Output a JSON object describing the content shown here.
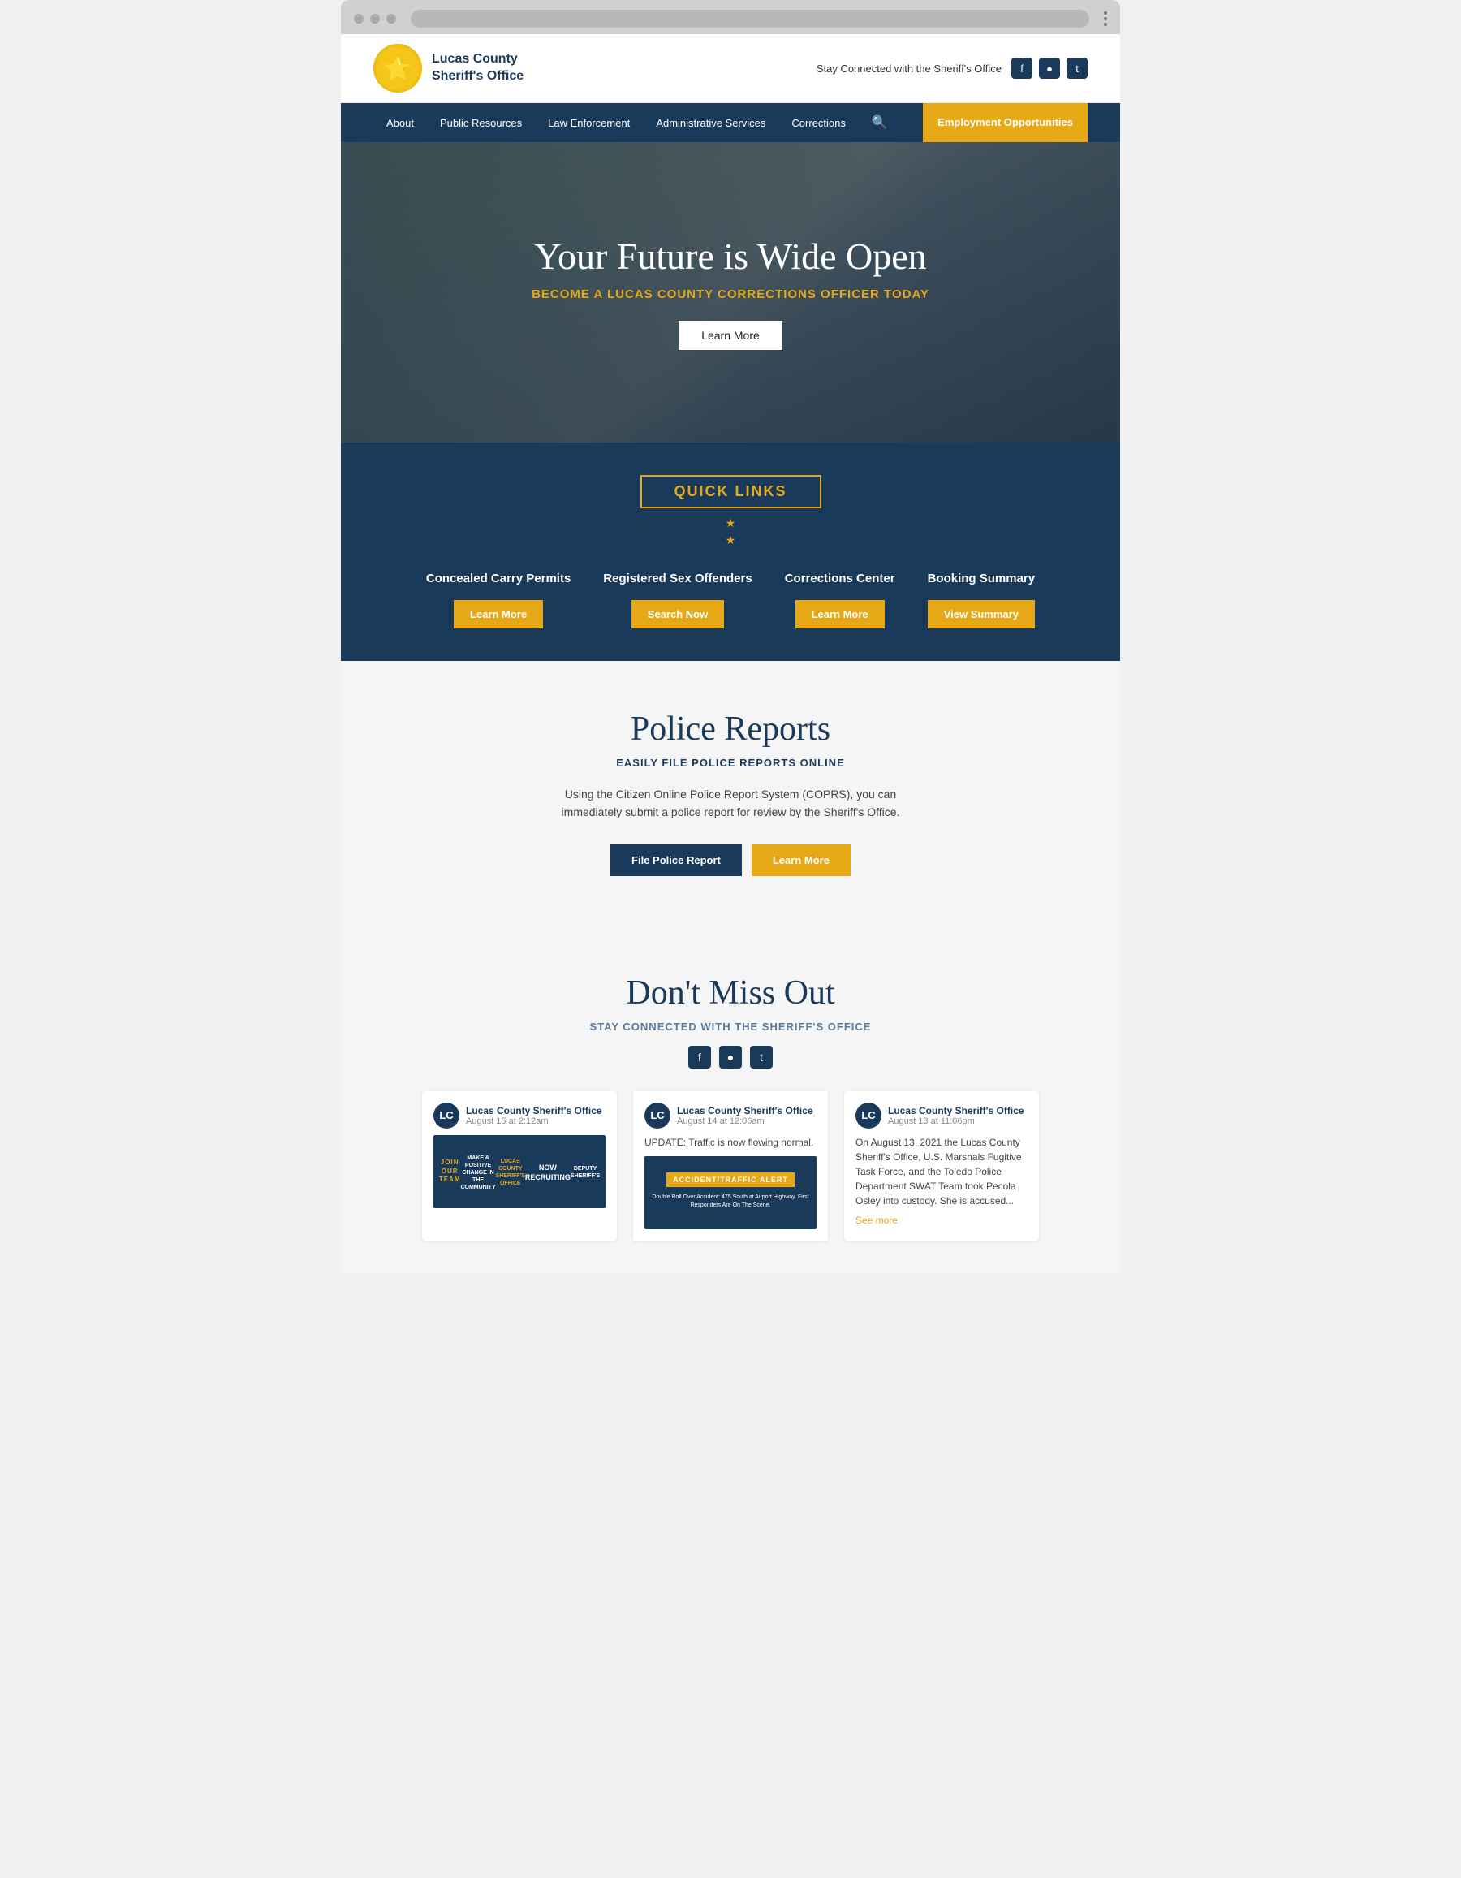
{
  "browser": {
    "dots": [
      "red-dot",
      "yellow-dot",
      "green-dot"
    ]
  },
  "header": {
    "logo_badge": "⭐",
    "logo_line1": "Lucas County",
    "logo_line2": "Sheriff's Office",
    "stay_connected": "Stay Connected with the Sheriff's Office",
    "social": {
      "facebook": "f",
      "instagram": "📷",
      "twitter": "t"
    }
  },
  "nav": {
    "items": [
      {
        "label": "About",
        "id": "about"
      },
      {
        "label": "Public Resources",
        "id": "public-resources"
      },
      {
        "label": "Law Enforcement",
        "id": "law-enforcement"
      },
      {
        "label": "Administrative Services",
        "id": "administrative-services"
      },
      {
        "label": "Corrections",
        "id": "corrections"
      }
    ],
    "employment_label": "Employment Opportunities"
  },
  "hero": {
    "title": "Your Future is Wide Open",
    "subtitle": "BECOME A LUCAS COUNTY CORRECTIONS OFFICER TODAY",
    "button_label": "Learn More"
  },
  "quick_links": {
    "section_title": "QUICK LINKS",
    "star": "★",
    "items": [
      {
        "name": "Concealed Carry Permits",
        "button_label": "Learn More",
        "button_id": "concealed-carry-btn"
      },
      {
        "name": "Registered Sex Offenders",
        "button_label": "Search Now",
        "button_id": "sex-offenders-btn"
      },
      {
        "name": "Corrections Center",
        "button_label": "Learn More",
        "button_id": "corrections-center-btn"
      },
      {
        "name": "Booking Summary",
        "button_label": "View Summary",
        "button_id": "booking-summary-btn"
      }
    ]
  },
  "police_reports": {
    "title": "Police Reports",
    "subtitle": "EASILY FILE POLICE REPORTS ONLINE",
    "description": "Using the Citizen Online Police Report System (COPRS), you can immediately submit a police report for review by the Sheriff's Office.",
    "btn_file": "File Police Report",
    "btn_learn": "Learn More"
  },
  "dont_miss": {
    "title": "Don't Miss Out",
    "subtitle": "STAY CONNECTED WITH THE SHERIFF'S OFFICE",
    "social": {
      "facebook": "f",
      "instagram": "📷",
      "twitter": "t"
    },
    "feed": [
      {
        "org": "Lucas County Sheriff's Office",
        "date": "August 15 at 2:12am",
        "text": "",
        "image_type": "join_team",
        "image_lines": [
          "JOIN OUR TEAM",
          "MAKE A POSITIVE CHANGE IN THE COMMUNITY",
          "LUCAS COUNTY SHERIFF'S OFFICE",
          "NOW RECRUITING",
          "DEPUTY SHERIFF'S"
        ]
      },
      {
        "org": "Lucas County Sheriff's Office",
        "date": "August 14 at 12:06am",
        "text": "UPDATE: Traffic is now flowing normal.",
        "image_type": "accident",
        "image_lines": [
          "ACCIDENT/TRAFFIC ALERT",
          "Double Roll Over Accident: 475 South at Airport Highway. First Responders Are On The Scene."
        ]
      },
      {
        "org": "Lucas County Sheriff's Office",
        "date": "August 13 at 11:06pm",
        "text": "On August 13, 2021 the Lucas County Sheriff's Office, U.S. Marshals Fugitive Task Force, and the Toledo Police Department SWAT Team took Pecola Osley into custody. She is accused...",
        "see_more": "See more",
        "image_type": "none"
      }
    ]
  }
}
